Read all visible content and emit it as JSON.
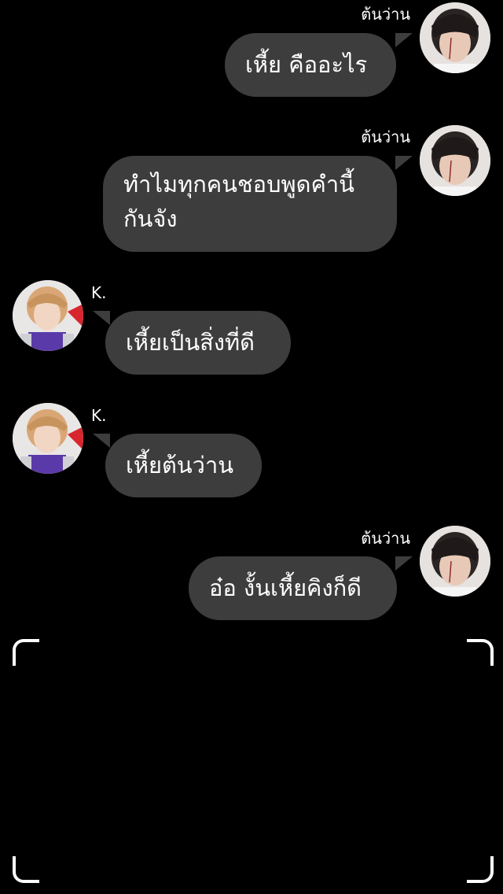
{
  "messages": [
    {
      "sender": "ต้นว่าน",
      "text": "เหี้ย คืออะไร"
    },
    {
      "sender": "ต้นว่าน",
      "text": "ทำไมทุกคนชอบพูดคำนี้กันจัง"
    },
    {
      "sender": "K.",
      "text": "เหี้ยเป็นสิ่งที่ดี"
    },
    {
      "sender": "K.",
      "text": "เหี้ยต้นว่าน"
    },
    {
      "sender": "ต้นว่าน",
      "text": "อ๋อ งั้นเหี้ยคิงก็ดี"
    }
  ],
  "colors": {
    "background": "#000000",
    "bubble": "#3d3d3d",
    "text": "#ffffff"
  }
}
